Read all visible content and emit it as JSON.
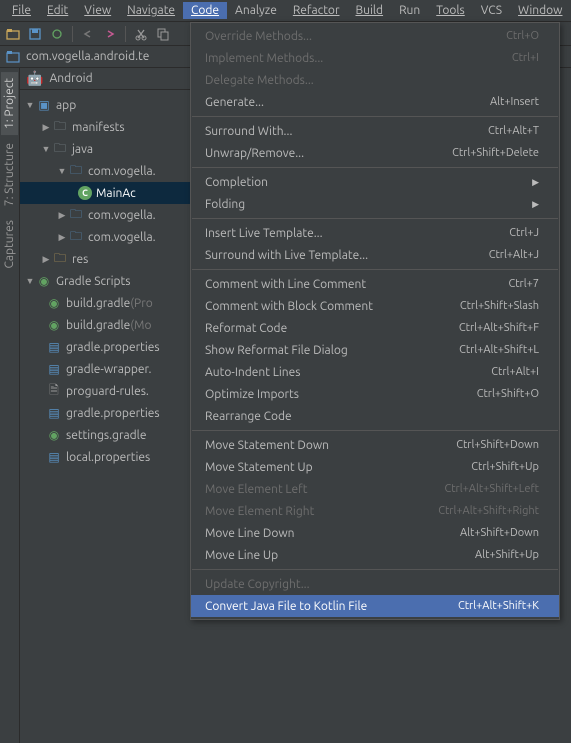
{
  "menubar": {
    "file": "File",
    "edit": "Edit",
    "view": "View",
    "navigate": "Navigate",
    "code": "Code",
    "analyze": "Analyze",
    "refactor": "Refactor",
    "build": "Build",
    "run": "Run",
    "tools": "Tools",
    "vcs": "VCS",
    "window": "Window"
  },
  "breadcrumb": {
    "project": "com.vogella.android.te"
  },
  "sidebar": {
    "project": "1: Project",
    "structure": "7: Structure",
    "captures": "Captures"
  },
  "project_header": "Android",
  "tree": {
    "app": "app",
    "manifests": "manifests",
    "java": "java",
    "pkg1": "com.vogella.",
    "main_activity": "MainAc",
    "pkg2": "com.vogella.",
    "pkg3": "com.vogella.",
    "res": "res",
    "gradle_scripts": "Gradle Scripts",
    "build_gradle_p": "build.gradle",
    "build_gradle_p_dim": " (Pro",
    "build_gradle_m": "build.gradle",
    "build_gradle_m_dim": " (Mo",
    "gradle_properties": "gradle.properties",
    "gradle_wrapper": "gradle-wrapper.",
    "proguard": "proguard-rules.",
    "gradle_properties2": "gradle.properties",
    "settings_gradle": "settings.gradle",
    "local_properties": "local.properties"
  },
  "menu": {
    "override_methods": {
      "label": "Override Methods...",
      "shortcut": "Ctrl+O"
    },
    "implement_methods": {
      "label": "Implement Methods...",
      "shortcut": "Ctrl+I"
    },
    "delegate_methods": {
      "label": "Delegate Methods...",
      "shortcut": ""
    },
    "generate": {
      "label": "Generate...",
      "shortcut": "Alt+Insert"
    },
    "surround_with": {
      "label": "Surround With...",
      "shortcut": "Ctrl+Alt+T"
    },
    "unwrap": {
      "label": "Unwrap/Remove...",
      "shortcut": "Ctrl+Shift+Delete"
    },
    "completion": {
      "label": "Completion",
      "shortcut": ""
    },
    "folding": {
      "label": "Folding",
      "shortcut": ""
    },
    "insert_template": {
      "label": "Insert Live Template...",
      "shortcut": "Ctrl+J"
    },
    "surround_template": {
      "label": "Surround with Live Template...",
      "shortcut": "Ctrl+Alt+J"
    },
    "line_comment": {
      "label": "Comment with Line Comment",
      "shortcut": "Ctrl+7"
    },
    "block_comment": {
      "label": "Comment with Block Comment",
      "shortcut": "Ctrl+Shift+Slash"
    },
    "reformat": {
      "label": "Reformat Code",
      "shortcut": "Ctrl+Alt+Shift+F"
    },
    "reformat_dialog": {
      "label": "Show Reformat File Dialog",
      "shortcut": "Ctrl+Alt+Shift+L"
    },
    "auto_indent": {
      "label": "Auto-Indent Lines",
      "shortcut": "Ctrl+Alt+I"
    },
    "optimize_imports": {
      "label": "Optimize Imports",
      "shortcut": "Ctrl+Shift+O"
    },
    "rearrange": {
      "label": "Rearrange Code",
      "shortcut": ""
    },
    "stmt_down": {
      "label": "Move Statement Down",
      "shortcut": "Ctrl+Shift+Down"
    },
    "stmt_up": {
      "label": "Move Statement Up",
      "shortcut": "Ctrl+Shift+Up"
    },
    "elem_left": {
      "label": "Move Element Left",
      "shortcut": "Ctrl+Alt+Shift+Left"
    },
    "elem_right": {
      "label": "Move Element Right",
      "shortcut": "Ctrl+Alt+Shift+Right"
    },
    "line_down": {
      "label": "Move Line Down",
      "shortcut": "Alt+Shift+Down"
    },
    "line_up": {
      "label": "Move Line Up",
      "shortcut": "Alt+Shift+Up"
    },
    "update_copyright": {
      "label": "Update Copyright...",
      "shortcut": ""
    },
    "convert_kotlin": {
      "label": "Convert Java File to Kotlin File",
      "shortcut": "Ctrl+Alt+Shift+K"
    }
  }
}
